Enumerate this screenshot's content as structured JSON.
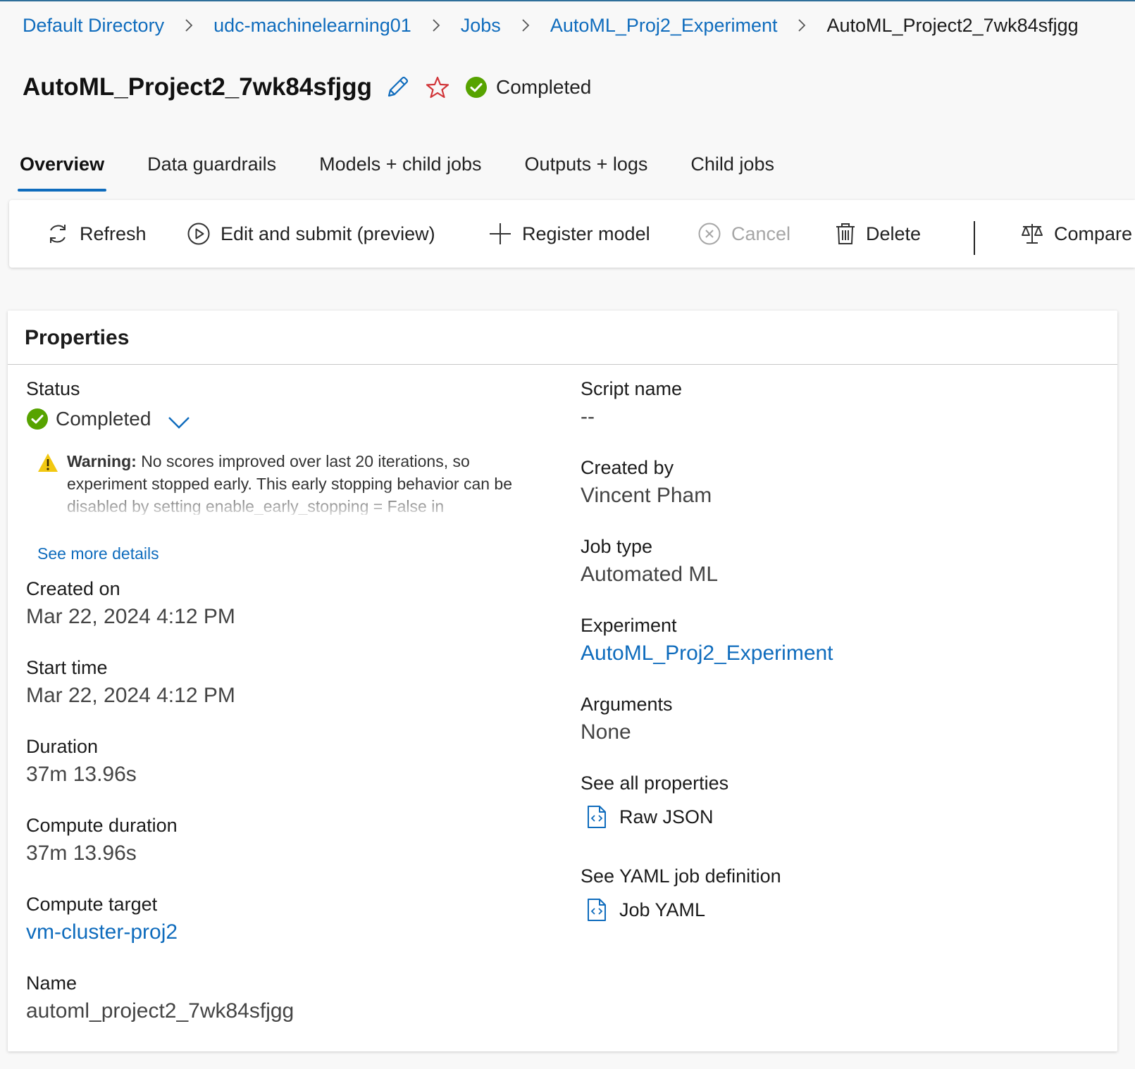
{
  "breadcrumb": [
    {
      "label": "Default Directory"
    },
    {
      "label": "udc-machinelearning01"
    },
    {
      "label": "Jobs"
    },
    {
      "label": "AutoML_Proj2_Experiment"
    },
    {
      "label": "AutoML_Project2_7wk84sfjgg"
    }
  ],
  "header": {
    "title": "AutoML_Project2_7wk84sfjgg",
    "status": "Completed"
  },
  "tabs": [
    {
      "label": "Overview",
      "active": true
    },
    {
      "label": "Data guardrails"
    },
    {
      "label": "Models + child jobs"
    },
    {
      "label": "Outputs + logs"
    },
    {
      "label": "Child jobs"
    }
  ],
  "toolbar": {
    "refresh": "Refresh",
    "edit_submit": "Edit and submit (preview)",
    "register_model": "Register model",
    "cancel": "Cancel",
    "delete": "Delete",
    "compare": "Compare"
  },
  "properties": {
    "title": "Properties",
    "status_label": "Status",
    "status_value": "Completed",
    "warning_prefix": "Warning:",
    "warning_text": "No scores improved over last 20 iterations, so experiment stopped early. This early stopping behavior can be disabled by setting enable_early_stopping = False in",
    "see_more": "See more details",
    "created_on_label": "Created on",
    "created_on": "Mar 22, 2024 4:12 PM",
    "start_time_label": "Start time",
    "start_time": "Mar 22, 2024 4:12 PM",
    "duration_label": "Duration",
    "duration": "37m 13.96s",
    "compute_duration_label": "Compute duration",
    "compute_duration": "37m 13.96s",
    "compute_target_label": "Compute target",
    "compute_target": "vm-cluster-proj2",
    "name_label": "Name",
    "name": "automl_project2_7wk84sfjgg",
    "script_name_label": "Script name",
    "script_name": "--",
    "created_by_label": "Created by",
    "created_by": "Vincent Pham",
    "job_type_label": "Job type",
    "job_type": "Automated ML",
    "experiment_label": "Experiment",
    "experiment": "AutoML_Proj2_Experiment",
    "arguments_label": "Arguments",
    "arguments": "None",
    "see_all_label": "See all properties",
    "raw_json": "Raw JSON",
    "yaml_label": "See YAML job definition",
    "job_yaml": "Job YAML"
  },
  "colors": {
    "link": "#0f6cbd",
    "success": "#57a300",
    "warning": "#f2c811",
    "star": "#d13438"
  },
  "icons": [
    "chevron-right-icon",
    "pencil-icon",
    "star-icon",
    "check-circle-icon",
    "refresh-icon",
    "play-circle-icon",
    "plus-icon",
    "cancel-circle-icon",
    "trash-icon",
    "scale-icon",
    "chevron-down-icon",
    "warning-icon",
    "code-file-icon"
  ]
}
